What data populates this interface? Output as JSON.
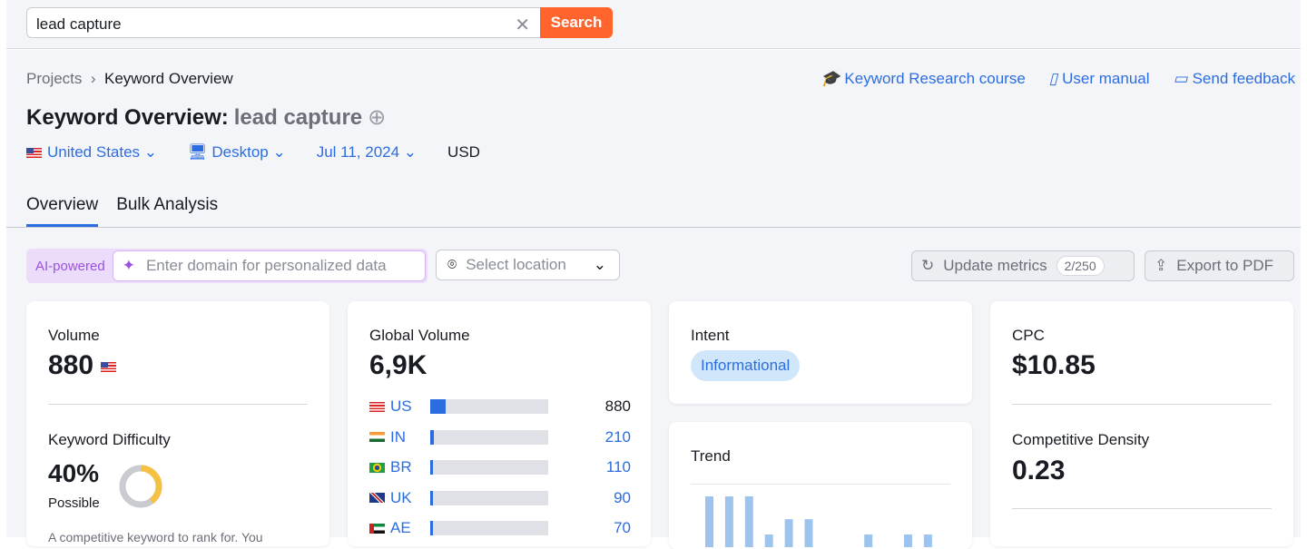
{
  "search": {
    "value": "lead capture",
    "button": "Search"
  },
  "breadcrumb": [
    "Projects",
    "Keyword Overview"
  ],
  "links": [
    "Keyword Research course",
    "User manual",
    "Send feedback"
  ],
  "title": {
    "label": "Keyword Overview:",
    "keyword": "lead capture"
  },
  "filters": {
    "country": "United States",
    "device": "Desktop",
    "date": "Jul 11, 2024",
    "currency": "USD"
  },
  "tabs": [
    "Overview",
    "Bulk Analysis"
  ],
  "toolbar": {
    "ai_label": "AI-powered",
    "domain_placeholder": "Enter domain for personalized data",
    "location_placeholder": "Select location",
    "update": "Update metrics",
    "update_count": "2/250",
    "export": "Export to PDF"
  },
  "volume": {
    "label": "Volume",
    "value": "880"
  },
  "kd": {
    "label": "Keyword Difficulty",
    "value": "40%",
    "level": "Possible",
    "percent": 40,
    "desc": "A competitive keyword to rank for. You"
  },
  "global": {
    "label": "Global Volume",
    "value": "6,9K",
    "rows": [
      {
        "code": "US",
        "value": "880",
        "share": 0.128
      },
      {
        "code": "IN",
        "value": "210",
        "share": 0.03
      },
      {
        "code": "BR",
        "value": "110",
        "share": 0.016
      },
      {
        "code": "UK",
        "value": "90",
        "share": 0.013
      },
      {
        "code": "AE",
        "value": "70",
        "share": 0.01
      }
    ]
  },
  "intent": {
    "label": "Intent",
    "value": "Informational"
  },
  "trend": {
    "label": "Trend",
    "values": [
      100,
      100,
      100,
      25,
      55,
      55,
      0,
      0,
      25,
      0,
      25,
      25
    ]
  },
  "cpc": {
    "label": "CPC",
    "value": "$10.85"
  },
  "density": {
    "label": "Competitive Density",
    "value": "0.23"
  },
  "colors": {
    "accent": "#2b6de1",
    "search": "#ff642d",
    "kd": "#f5c142",
    "trend": "#9cc4ee"
  }
}
